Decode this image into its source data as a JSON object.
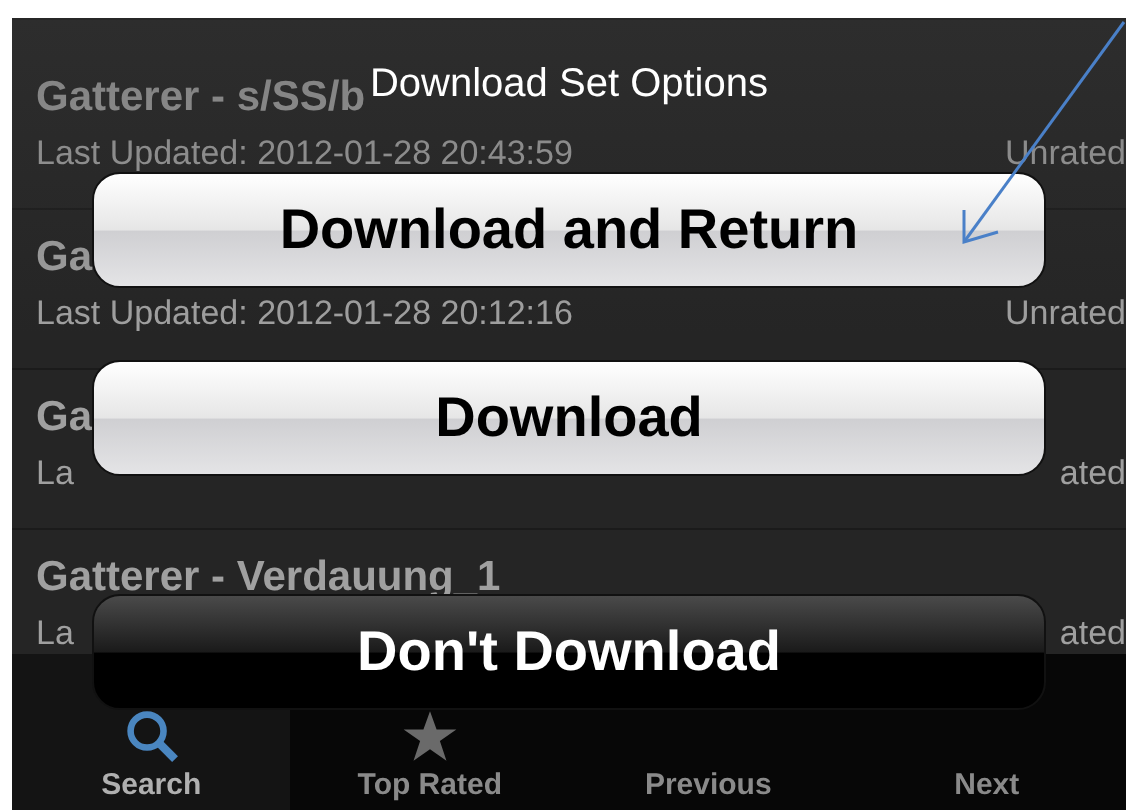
{
  "list": {
    "rows": [
      {
        "title": "Gatterer - s/SS/b",
        "updated": "Last Updated: 2012-01-28 20:43:59",
        "rating": "Unrated"
      },
      {
        "title": "Ga",
        "updated": "Last Updated: 2012-01-28 20:12:16",
        "rating": "Unrated"
      },
      {
        "title": "Ga",
        "updated": "La",
        "rating": "ated"
      },
      {
        "title": "Gatterer - Verdauung_1",
        "updated": "La",
        "rating": "ated"
      }
    ]
  },
  "tab_bar": {
    "tabs": [
      {
        "label": "Search",
        "selected": true,
        "kind": "search"
      },
      {
        "label": "Top Rated",
        "selected": false,
        "kind": "star"
      },
      {
        "label": "Previous",
        "selected": false,
        "kind": "none"
      },
      {
        "label": "Next",
        "selected": false,
        "kind": "none"
      }
    ]
  },
  "action_sheet": {
    "title": "Download Set Options",
    "buttons": [
      {
        "label": "Download and Return",
        "kind": "default"
      },
      {
        "label": "Download",
        "kind": "default"
      },
      {
        "label": "Don't Download",
        "kind": "cancel"
      }
    ]
  }
}
